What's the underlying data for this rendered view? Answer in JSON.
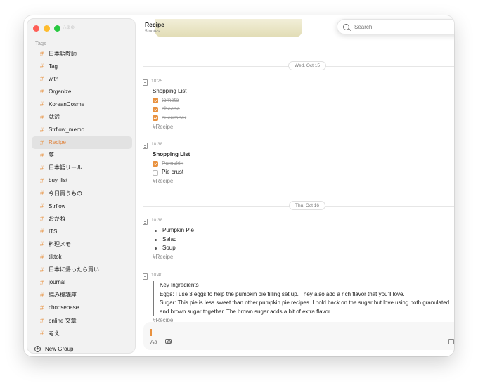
{
  "sidebar": {
    "faint_text": "ஃ⊕⊕",
    "tags_header": "Tags",
    "tags": [
      "日本語教師",
      "Tag",
      "with",
      "Organize",
      "KoreanCosme",
      "就活",
      "Strflow_memo",
      "Recipe",
      "夢",
      "日本語リール",
      "buy_list",
      "今日買うもの",
      "Strflow",
      "おかね",
      "ITS",
      "料理メモ",
      "tiktok",
      "日本に帰ったら買い…",
      "journal",
      "編み機講座",
      "choosebase",
      "online 文章",
      "考え"
    ],
    "selected_index": 7,
    "new_group_label": "New Group"
  },
  "header": {
    "title": "Recipe",
    "subtitle": "5 notes"
  },
  "search": {
    "placeholder": "Search"
  },
  "date_separators": [
    "Wed, Oct 15",
    "Thu, Oct 16"
  ],
  "notes": [
    {
      "time": "18:25",
      "title": "Shopping List",
      "items": [
        {
          "text": "tomato",
          "checked": true
        },
        {
          "text": "cheese",
          "checked": true
        },
        {
          "text": "cucumber",
          "checked": true
        }
      ],
      "tag": "#Recipe"
    },
    {
      "time": "18:38",
      "title": "Shopping List",
      "items": [
        {
          "text": "Pumpkin",
          "checked": true
        },
        {
          "text": "Pie crust",
          "checked": false
        }
      ],
      "tag": "#Recipe"
    },
    {
      "time": "10:38",
      "bullets": [
        "Pumpkin Pie",
        "Salad",
        "Soup"
      ],
      "tag": "#Recipe"
    },
    {
      "time": "10:40",
      "quote": [
        "Key Ingredients",
        "Eggs: I use 3 eggs to help the pumpkin pie filling set up. They also add a rich flavor that you'll love.",
        "Sugar: This pie is less sweet than other pumpkin pie recipes. I hold back on the sugar but love using both granulated",
        "and brown sugar together. The brown sugar adds a bit of extra flavor."
      ],
      "tag": "#Recipe"
    }
  ],
  "composer": {
    "format_label": "Aa"
  },
  "colors": {
    "accent": "#e8913f",
    "sidebar_bg": "#f2f2f2",
    "selected_bg": "#e2e2e2"
  },
  "icons": [
    "search-icon",
    "note-icon",
    "plus-circle-icon",
    "attach-photo-icon",
    "calendar-icon",
    "send-arrow-icon"
  ]
}
